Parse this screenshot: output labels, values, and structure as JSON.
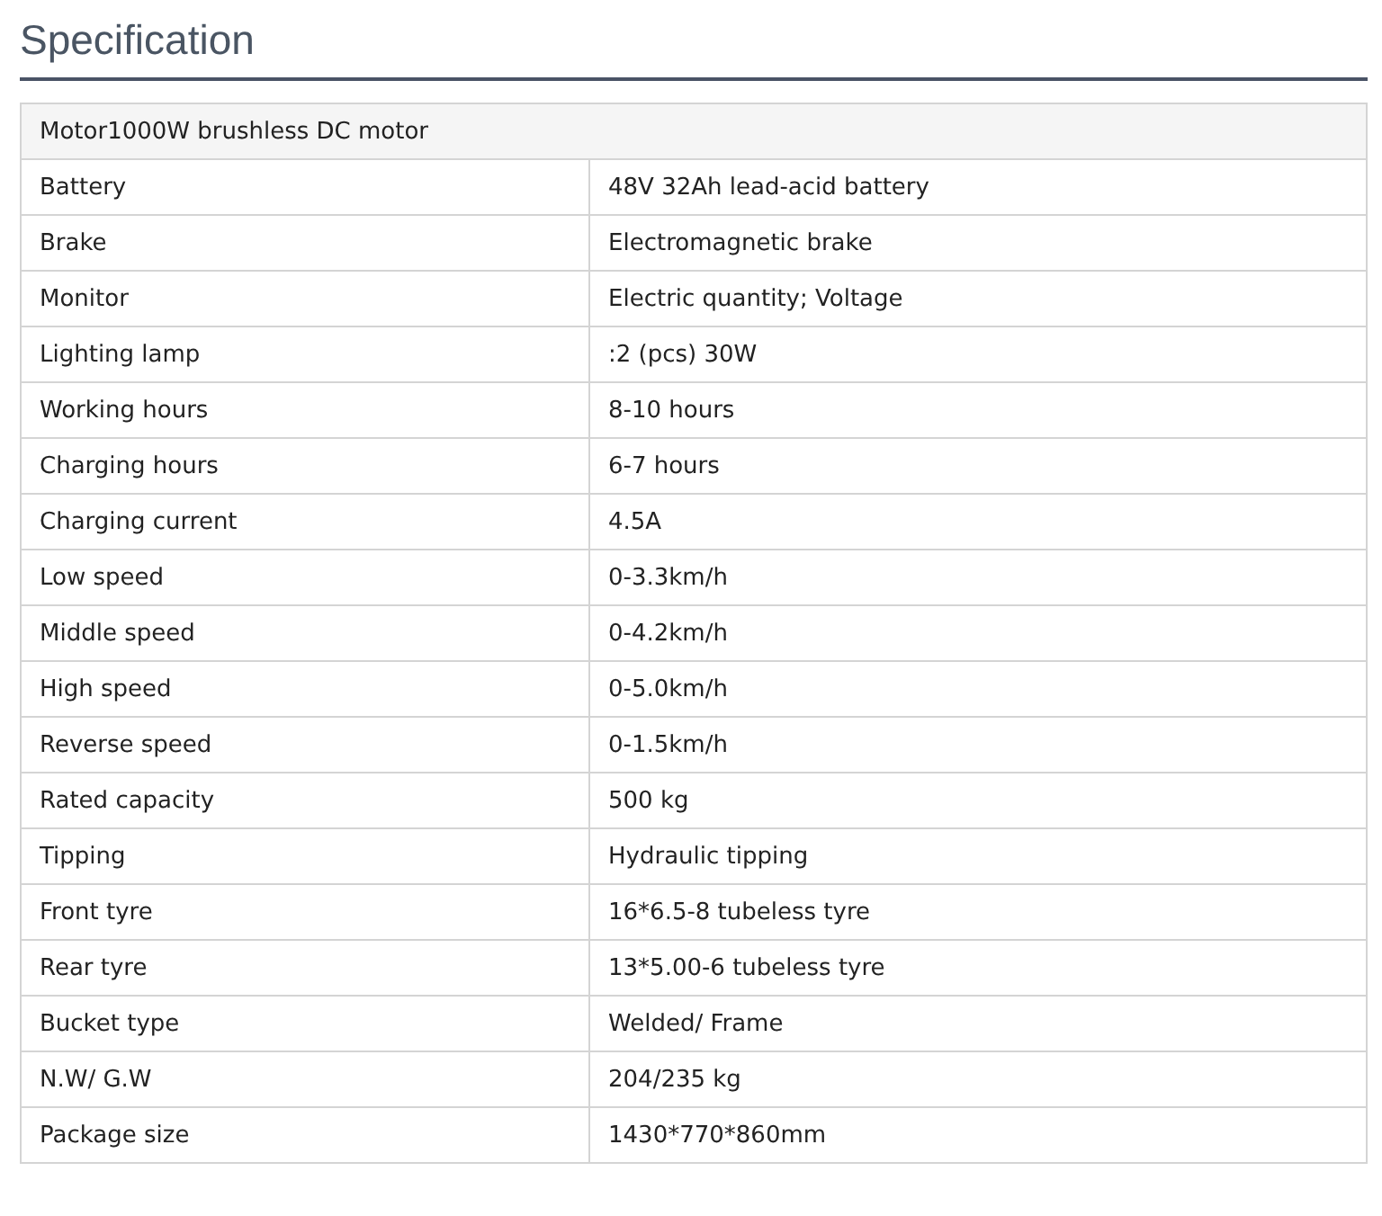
{
  "title": "Specification",
  "table": {
    "header": "Motor1000W brushless DC motor",
    "rows": [
      {
        "label": "Battery",
        "value": "48V 32Ah lead-acid battery"
      },
      {
        "label": "Brake",
        "value": "Electromagnetic brake"
      },
      {
        "label": "Monitor",
        "value": "Electric quantity; Voltage"
      },
      {
        "label": "Lighting lamp",
        "value": ":2 (pcs) 30W"
      },
      {
        "label": "Working hours",
        "value": "8-10 hours"
      },
      {
        "label": "Charging hours",
        "value": "6-7 hours"
      },
      {
        "label": "Charging current",
        "value": "4.5A"
      },
      {
        "label": "Low speed",
        "value": "0-3.3km/h"
      },
      {
        "label": "Middle speed",
        "value": "0-4.2km/h"
      },
      {
        "label": "High speed",
        "value": "0-5.0km/h"
      },
      {
        "label": "Reverse speed",
        "value": "0-1.5km/h"
      },
      {
        "label": "Rated capacity",
        "value": "500 kg"
      },
      {
        "label": "Tipping",
        "value": "Hydraulic tipping"
      },
      {
        "label": "Front tyre",
        "value": "16*6.5-8 tubeless tyre"
      },
      {
        "label": "Rear tyre",
        "value": "13*5.00-6 tubeless tyre"
      },
      {
        "label": "Bucket type",
        "value": "Welded/ Frame"
      },
      {
        "label": "N.W/ G.W",
        "value": "204/235 kg"
      },
      {
        "label": "Package size",
        "value": "1430*770*860mm"
      }
    ]
  }
}
